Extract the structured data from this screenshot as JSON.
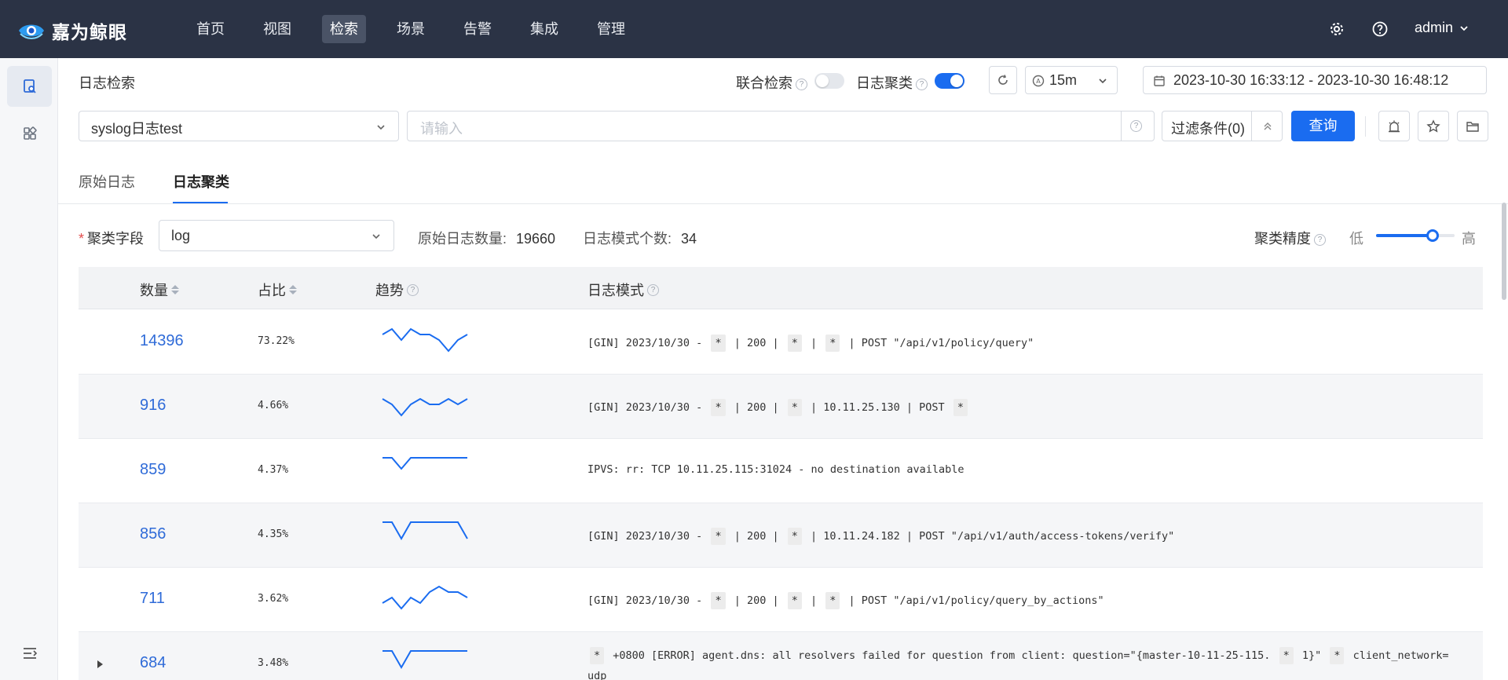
{
  "brand": {
    "name": "嘉为鲸眼"
  },
  "nav": {
    "items": [
      {
        "label": "首页"
      },
      {
        "label": "视图"
      },
      {
        "label": "检索",
        "active": true
      },
      {
        "label": "场景"
      },
      {
        "label": "告警"
      },
      {
        "label": "集成"
      },
      {
        "label": "管理"
      }
    ],
    "user": "admin"
  },
  "header": {
    "title": "日志检索",
    "joint_search_label": "联合检索",
    "joint_search_on": false,
    "clustering_label": "日志聚类",
    "clustering_on": true,
    "refresh_interval": "15m",
    "time_range": "2023-10-30 16:33:12 - 2023-10-30 16:48:12"
  },
  "query": {
    "source": "syslog日志test",
    "placeholder": "请输入",
    "filter_label": "过滤条件(0)",
    "submit_label": "查询"
  },
  "tabs": [
    {
      "label": "原始日志"
    },
    {
      "label": "日志聚类",
      "active": true
    }
  ],
  "cluster": {
    "field_label": "聚类字段",
    "field_value": "log",
    "raw_count_label": "原始日志数量:",
    "raw_count": "19660",
    "pattern_count_label": "日志模式个数:",
    "pattern_count": "34",
    "precision_label": "聚类精度",
    "precision_low": "低",
    "precision_high": "高",
    "precision_level": 0.72
  },
  "table": {
    "headers": {
      "count": "数量",
      "ratio": "占比",
      "trend": "趋势",
      "pattern": "日志模式"
    },
    "rows": [
      {
        "count": "14396",
        "ratio": "73.22%",
        "trend": [
          6,
          7,
          5,
          7,
          6,
          6,
          5,
          3,
          5,
          6
        ],
        "pattern": [
          {
            "t": "[GIN] 2023/10/30 - "
          },
          {
            "tok": "*"
          },
          {
            "t": " | 200 | "
          },
          {
            "tok": "*"
          },
          {
            "t": " | "
          },
          {
            "tok": "*"
          },
          {
            "t": " | POST \"/api/v1/policy/query\""
          }
        ]
      },
      {
        "count": "916",
        "ratio": "4.66%",
        "trend": [
          6,
          5,
          3,
          5,
          6,
          5,
          5,
          6,
          5,
          6
        ],
        "pattern": [
          {
            "t": "[GIN] 2023/10/30 - "
          },
          {
            "tok": "*"
          },
          {
            "t": " | 200 | "
          },
          {
            "tok": "*"
          },
          {
            "t": " | 10.11.25.130 | POST "
          },
          {
            "tok": "*"
          }
        ]
      },
      {
        "count": "859",
        "ratio": "4.37%",
        "trend": [
          7,
          7,
          5,
          7,
          7,
          7,
          7,
          7,
          7,
          7
        ],
        "pattern": [
          {
            "t": "IPVS: rr: TCP 10.11.25.115:31024 - no destination available"
          }
        ]
      },
      {
        "count": "856",
        "ratio": "4.35%",
        "trend": [
          7,
          7,
          4,
          7,
          7,
          7,
          7,
          7,
          7,
          4
        ],
        "pattern": [
          {
            "t": "[GIN] 2023/10/30 - "
          },
          {
            "tok": "*"
          },
          {
            "t": " | 200 | "
          },
          {
            "tok": "*"
          },
          {
            "t": " | 10.11.24.182 | POST \"/api/v1/auth/access-tokens/verify\""
          }
        ]
      },
      {
        "count": "711",
        "ratio": "3.62%",
        "trend": [
          4,
          5,
          3,
          5,
          4,
          6,
          7,
          6,
          6,
          5
        ],
        "pattern": [
          {
            "t": "[GIN] 2023/10/30 - "
          },
          {
            "tok": "*"
          },
          {
            "t": " | 200 | "
          },
          {
            "tok": "*"
          },
          {
            "t": " | "
          },
          {
            "tok": "*"
          },
          {
            "t": " | POST \"/api/v1/policy/query_by_actions\""
          }
        ]
      },
      {
        "count": "684",
        "ratio": "3.48%",
        "expandable": true,
        "trend": [
          7,
          7,
          4,
          7,
          7,
          7,
          7,
          7,
          7,
          7
        ],
        "pattern": [
          {
            "tok": "*"
          },
          {
            "t": " +0800 [ERROR] agent.dns: all resolvers failed for question from client: question=\"{master-10-11-25-115. "
          },
          {
            "tok": "*"
          },
          {
            "t": " 1}\" "
          },
          {
            "tok": "*"
          },
          {
            "t": " client_network=udp"
          }
        ]
      }
    ]
  },
  "colors": {
    "accent": "#1a6cf0",
    "nav_bg": "#2b3345",
    "link": "#2f6bd8"
  }
}
